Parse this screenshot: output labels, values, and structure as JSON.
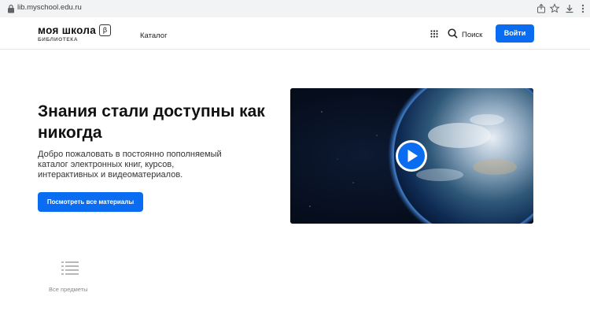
{
  "browser": {
    "url": "lib.myschool.edu.ru",
    "icons": [
      "lock-icon",
      "share-icon",
      "star-icon",
      "download-icon",
      "menu-dots-icon"
    ]
  },
  "header": {
    "logo_title": "моя школа",
    "logo_beta": "β",
    "logo_subtitle": "БИБЛИОТЕКА",
    "nav_catalog": "Каталог",
    "search_label": "Поиск",
    "login_label": "Войти"
  },
  "hero": {
    "title": "Знания стали доступны как никогда",
    "text": "Добро пожаловать в постоянно пополняемый каталог электронных книг, курсов, интерактивных и видеоматериалов.",
    "cta_label": "Посмотреть все материалы"
  },
  "subjects": {
    "all_label": "Все предметы"
  },
  "colors": {
    "accent": "#0a6cf0",
    "text": "#1a1a1a",
    "muted": "#8a8a8a"
  }
}
